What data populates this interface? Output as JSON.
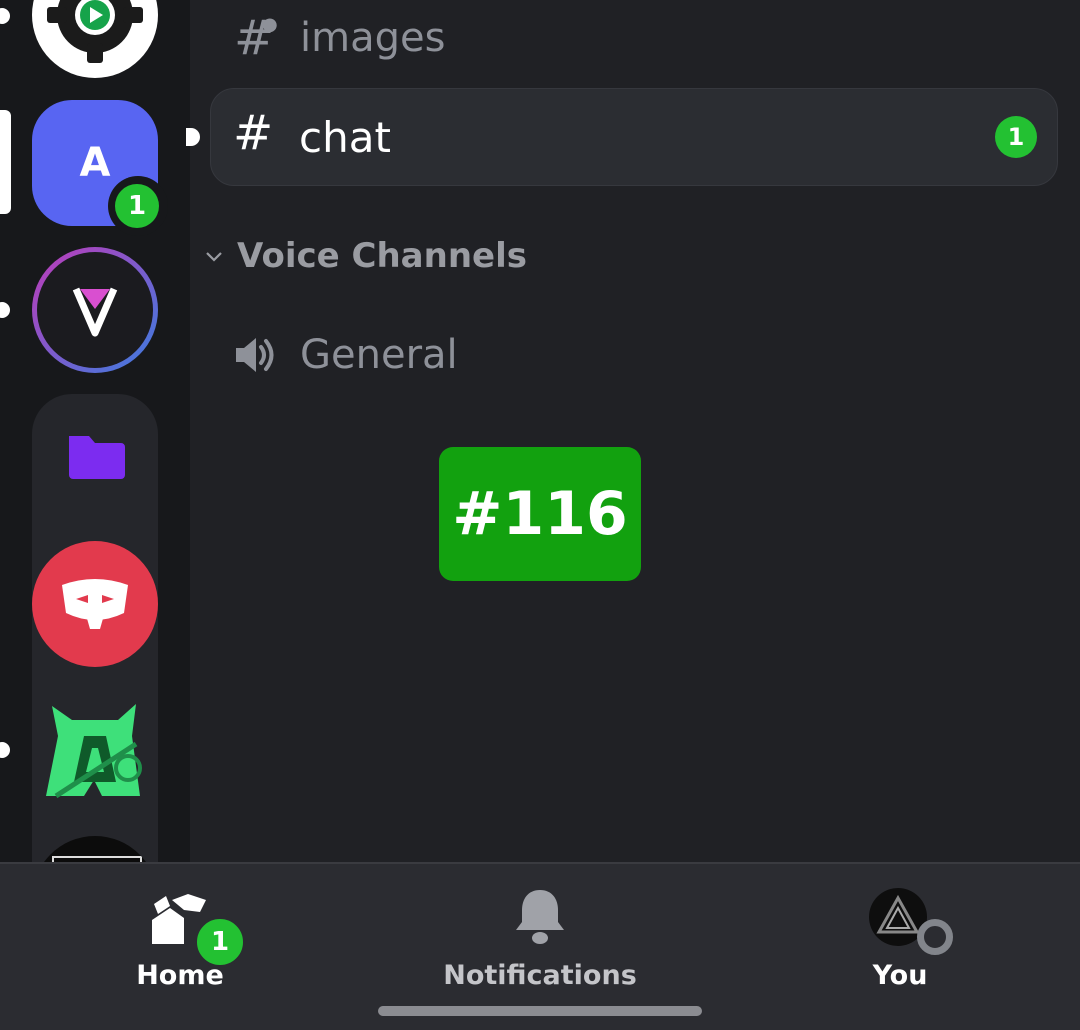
{
  "channels": {
    "text": [
      {
        "name": "images",
        "icon": "locked-hash-icon"
      },
      {
        "name": "chat",
        "icon": "hash-icon",
        "unread": "1"
      }
    ],
    "voice_category": "Voice Channels",
    "voice": [
      {
        "name": "General",
        "icon": "speaker-icon"
      }
    ]
  },
  "servers": [
    {
      "icon": "gear-play-icon"
    },
    {
      "initial": "A",
      "badge": "1",
      "color": "#5865f2"
    },
    {
      "icon": "v-logo-icon"
    },
    {
      "icon": "folder-icon",
      "color": "#7c2cf0"
    },
    {
      "icon": "discord-mask-icon",
      "color": "#e23a4d"
    },
    {
      "icon": "green-a-logo-icon"
    }
  ],
  "overlay_tag": "#116",
  "nav": {
    "home": {
      "label": "Home",
      "badge": "1"
    },
    "notifications": {
      "label": "Notifications"
    },
    "you": {
      "label": "You"
    }
  },
  "colors": {
    "green": "#23c132",
    "tag_green": "#12a10f"
  }
}
